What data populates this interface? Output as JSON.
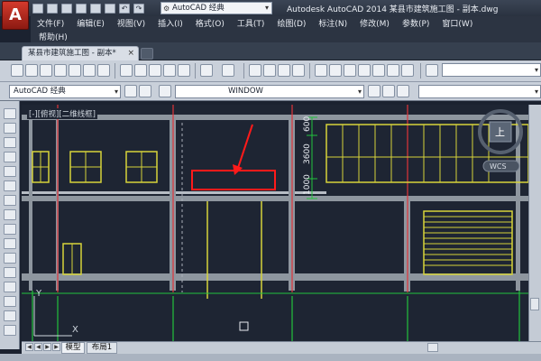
{
  "app": {
    "button_letter": "A",
    "window_title": "Autodesk AutoCAD 2014    某县市建筑施工图 - 副本.dwg"
  },
  "quick_access": {
    "workspace": "AutoCAD 经典"
  },
  "menu": {
    "items": [
      "文件(F)",
      "编辑(E)",
      "视图(V)",
      "插入(I)",
      "格式(O)",
      "工具(T)",
      "绘图(D)",
      "标注(N)",
      "修改(M)",
      "参数(P)",
      "窗口(W)"
    ],
    "help": "帮助(H)"
  },
  "document_tab": {
    "label": "某县市建筑施工图 - 副本*",
    "close": "×"
  },
  "toolbar2": {
    "workspace_combo": "AutoCAD 经典",
    "layer_combo": "WINDOW"
  },
  "drawing": {
    "view_label": "[-][俯视][二维线框]",
    "dimensions": [
      "600",
      "3600",
      "1000"
    ],
    "viewcube_label": "上",
    "wcs_label": "WCS",
    "ucs_y": "Y",
    "ucs_x": "X"
  },
  "layout_tabs": {
    "model": "模型",
    "layout1": "布局1"
  },
  "colors": {
    "background": "#1e2533",
    "wall": "#8e969f",
    "window_yellow": "#d7d43a",
    "red_axis": "#e0343a",
    "green_dim": "#23c23c",
    "highlight": "#ff1a1a"
  }
}
